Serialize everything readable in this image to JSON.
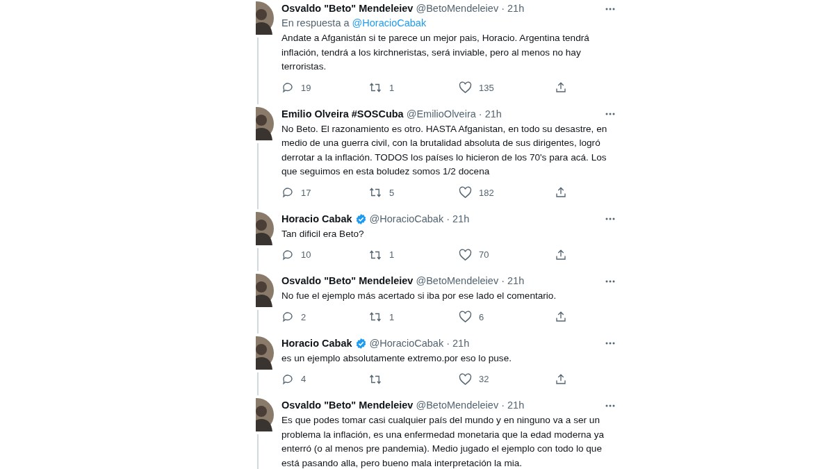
{
  "tweets": [
    {
      "name": "Osvaldo \"Beto\" Mendeleiev",
      "verified": false,
      "meta": "@BetoMendeleiev · 21h",
      "reply_to": {
        "prefix": "En respuesta a",
        "handle": "@HoracioCabak"
      },
      "text": "Andate a Afganistán si te parece un mejor pais, Horacio. Argentina tendrá inflación, tendrá a los kirchneristas, será inviable, pero al menos no hay terroristas.",
      "replies": "19",
      "retweets": "1",
      "likes": "135"
    },
    {
      "name": "Emilio Olveira #SOSCuba",
      "verified": false,
      "meta": "@EmilioOlveira · 21h",
      "text": "No Beto. El razonamiento es otro. HASTA Afganistan, en todo su desastre, en medio de una guerra civil, con la brutalidad absoluta de sus dirigentes, logró derrotar a la inflación. TODOS los países lo hicieron de los 70's para acá. Los que seguimos en esta boludez somos 1/2 docena",
      "replies": "17",
      "retweets": "5",
      "likes": "182"
    },
    {
      "name": "Horacio Cabak",
      "verified": true,
      "meta": "@HoracioCabak · 21h",
      "text": "Tan dificil era Beto?",
      "replies": "10",
      "retweets": "1",
      "likes": "70"
    },
    {
      "name": "Osvaldo \"Beto\" Mendeleiev",
      "verified": false,
      "meta": "@BetoMendeleiev · 21h",
      "text": "No fue el ejemplo más acertado si iba por ese lado el comentario.",
      "replies": "2",
      "retweets": "1",
      "likes": "6"
    },
    {
      "name": "Horacio Cabak",
      "verified": true,
      "meta": "@HoracioCabak · 21h",
      "text": "es un ejemplo absolutamente extremo.por eso lo puse.",
      "replies": "4",
      "likes": "32"
    },
    {
      "name": "Osvaldo \"Beto\" Mendeleiev",
      "verified": false,
      "meta": "@BetoMendeleiev · 21h",
      "text": "Es que podes tomar casi cualquier país del mundo y en ninguno va a ser un problema la inflación, es una enfermedad monetaria que la edad moderna ya enterró (o al menos pre pandemia). Medio jugado el ejemplo con todo lo que está pasando alla, pero bueno mala interpretación la mia."
    }
  ]
}
